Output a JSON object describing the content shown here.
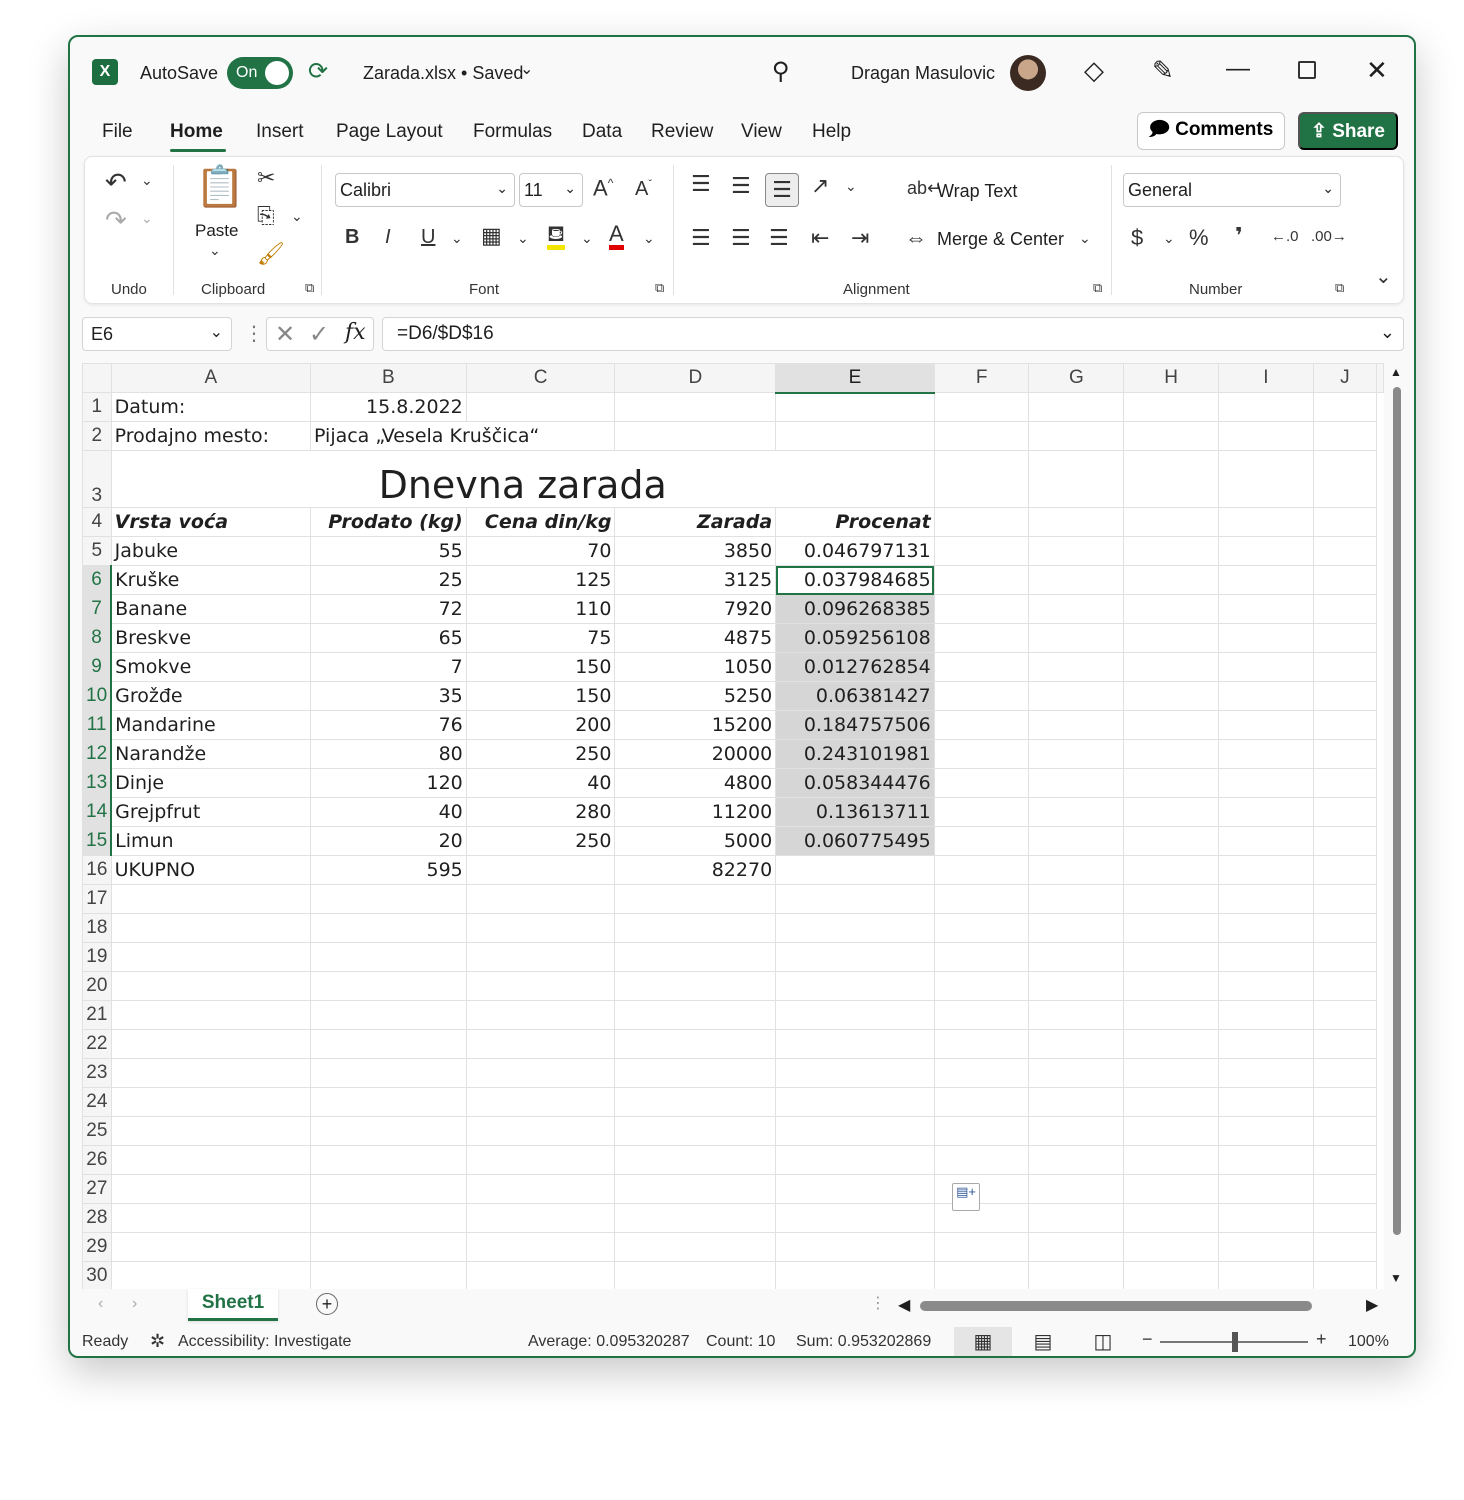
{
  "titlebar": {
    "autosave_label": "AutoSave",
    "autosave_state": "On",
    "filename": "Zarada.xlsx • Saved",
    "user_name": "Dragan Masulovic"
  },
  "tabs": [
    "File",
    "Home",
    "Insert",
    "Page Layout",
    "Formulas",
    "Data",
    "Review",
    "View",
    "Help"
  ],
  "actions": {
    "comments": "Comments",
    "share": "Share"
  },
  "ribbon": {
    "undo_group": "Undo",
    "clipboard_group": "Clipboard",
    "paste_label": "Paste",
    "font_group": "Font",
    "font_name": "Calibri",
    "font_size": "11",
    "alignment_group": "Alignment",
    "wrap_text": "Wrap Text",
    "merge_center": "Merge & Center",
    "number_group": "Number",
    "number_format": "General"
  },
  "formula_bar": {
    "name_box": "E6",
    "formula": "=D6/$D$16"
  },
  "sheet": {
    "columns": [
      "A",
      "B",
      "C",
      "D",
      "E",
      "F",
      "G",
      "H",
      "I",
      "J"
    ],
    "datum_label": "Datum:",
    "datum_value": "15.8.2022",
    "mesto_label": "Prodajno mesto:",
    "mesto_value": "Pijaca „Vesela Kruščica“",
    "title": "Dnevna zarada",
    "headers": [
      "Vrsta voća",
      "Prodato (kg)",
      "Cena din/kg",
      "Zarada",
      "Procenat"
    ],
    "rows": [
      [
        "Jabuke",
        "55",
        "70",
        "3850",
        "0.046797131"
      ],
      [
        "Kruške",
        "25",
        "125",
        "3125",
        "0.037984685"
      ],
      [
        "Banane",
        "72",
        "110",
        "7920",
        "0.096268385"
      ],
      [
        "Breskve",
        "65",
        "75",
        "4875",
        "0.059256108"
      ],
      [
        "Smokve",
        "7",
        "150",
        "1050",
        "0.012762854"
      ],
      [
        "Grožđe",
        "35",
        "150",
        "5250",
        "0.06381427"
      ],
      [
        "Mandarine",
        "76",
        "200",
        "15200",
        "0.184757506"
      ],
      [
        "Narandže",
        "80",
        "250",
        "20000",
        "0.243101981"
      ],
      [
        "Dinje",
        "120",
        "40",
        "4800",
        "0.058344476"
      ],
      [
        "Grejpfrut",
        "40",
        "280",
        "11200",
        "0.13613711"
      ],
      [
        "Limun",
        "20",
        "250",
        "5000",
        "0.060775495"
      ]
    ],
    "total_label": "UKUPNO",
    "total_kg": "595",
    "total_zarada": "82270"
  },
  "sheet_tab": "Sheet1",
  "status": {
    "ready": "Ready",
    "accessibility": "Accessibility: Investigate",
    "average": "Average: 0.095320287",
    "count": "Count: 10",
    "sum": "Sum: 0.953202869",
    "zoom": "100%"
  },
  "colors": {
    "accent": "#217346",
    "selection": "#d6d6d6"
  }
}
